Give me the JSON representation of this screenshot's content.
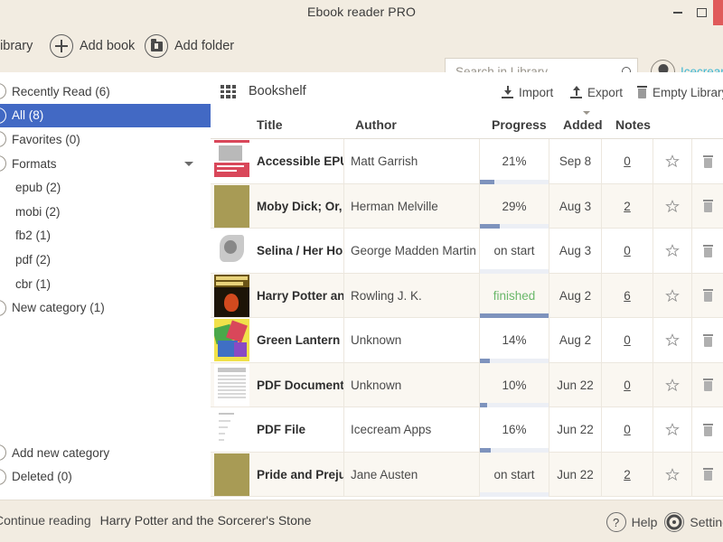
{
  "window": {
    "title": "Ebook reader PRO",
    "minimize_label": "–",
    "maximize_label": "□",
    "close_label": "×"
  },
  "toolbar": {
    "library_label": "Library",
    "add_book_label": "Add book",
    "add_folder_label": "Add folder",
    "search_placeholder": "Search in Library",
    "search_value": "",
    "account_name": "Icecream"
  },
  "sidebar": {
    "top_items": [
      {
        "label": "Recently Read (6)",
        "selected": false,
        "sub": false,
        "caret": false
      },
      {
        "label": "All (8)",
        "selected": true,
        "sub": false,
        "caret": false
      },
      {
        "label": "Favorites (0)",
        "selected": false,
        "sub": false,
        "caret": false
      },
      {
        "label": "Formats",
        "selected": false,
        "sub": false,
        "caret": true
      },
      {
        "label": "epub (2)",
        "selected": false,
        "sub": true,
        "caret": false
      },
      {
        "label": "mobi (2)",
        "selected": false,
        "sub": true,
        "caret": false
      },
      {
        "label": "fb2 (1)",
        "selected": false,
        "sub": true,
        "caret": false
      },
      {
        "label": "pdf (2)",
        "selected": false,
        "sub": true,
        "caret": false
      },
      {
        "label": "cbr (1)",
        "selected": false,
        "sub": true,
        "caret": false
      },
      {
        "label": "New category (1)",
        "selected": false,
        "sub": false,
        "caret": false
      }
    ],
    "bottom_items": [
      {
        "label": "Add new category",
        "selected": false,
        "sub": false,
        "caret": false
      },
      {
        "label": "Deleted (0)",
        "selected": false,
        "sub": false,
        "caret": false
      }
    ]
  },
  "main": {
    "view_label": "Bookshelf",
    "import_label": "Import",
    "export_label": "Export",
    "empty_library_label": "Empty Library",
    "columns": {
      "title": "Title",
      "author": "Author",
      "progress": "Progress",
      "added": "Added",
      "notes": "Notes"
    },
    "sorted_column": "Added",
    "rows": [
      {
        "title": "Accessible EPUB",
        "author": "Matt Garrish",
        "progress_label": "21%",
        "progress_percent": 21,
        "finished": false,
        "added": "Sep 8",
        "notes": "0",
        "favorite": false,
        "cover": "accessible-epub-cover"
      },
      {
        "title": "Moby Dick; Or,",
        "author": "Herman Melville",
        "progress_label": "29%",
        "progress_percent": 29,
        "finished": false,
        "added": "Aug 3",
        "notes": "2",
        "favorite": false,
        "cover": "moby-dick-cover"
      },
      {
        "title": "Selina / Her Ho",
        "author": "George Madden Martin",
        "progress_label": "on start",
        "progress_percent": 0,
        "finished": false,
        "added": "Aug 3",
        "notes": "0",
        "favorite": false,
        "cover": "selina-cover"
      },
      {
        "title": "Harry Potter an",
        "author": "Rowling J. K.",
        "progress_label": "finished",
        "progress_percent": 100,
        "finished": true,
        "added": "Aug 2",
        "notes": "6",
        "favorite": false,
        "cover": "harry-potter-cover"
      },
      {
        "title": "Green Lantern v",
        "author": "Unknown",
        "progress_label": "14%",
        "progress_percent": 14,
        "finished": false,
        "added": "Aug 2",
        "notes": "0",
        "favorite": false,
        "cover": "green-lantern-cover"
      },
      {
        "title": "PDF Document",
        "author": "Unknown",
        "progress_label": "10%",
        "progress_percent": 10,
        "finished": false,
        "added": "Jun 22",
        "notes": "0",
        "favorite": false,
        "cover": "pdf-document-cover"
      },
      {
        "title": "PDF File",
        "author": "Icecream Apps",
        "progress_label": "16%",
        "progress_percent": 16,
        "finished": false,
        "added": "Jun 22",
        "notes": "0",
        "favorite": false,
        "cover": "pdf-file-cover"
      },
      {
        "title": "Pride and Preju",
        "author": "Jane Austen",
        "progress_label": "on start",
        "progress_percent": 0,
        "finished": false,
        "added": "Jun 22",
        "notes": "2",
        "favorite": false,
        "cover": "pride-prejudice-cover"
      }
    ]
  },
  "statusbar": {
    "continue_label": "Continue reading",
    "continue_book": "Harry Potter and the Sorcerer's Stone",
    "help_label": "Help",
    "settings_label": "Settings"
  },
  "colors": {
    "chrome": "#f2ece1",
    "selection": "#4269c4",
    "accent_link": "#3fb8d4",
    "progress_fill": "#7e93bd",
    "progress_track": "#eceff5",
    "finished_text": "#6ab86a",
    "close_button": "#e05a5a"
  }
}
